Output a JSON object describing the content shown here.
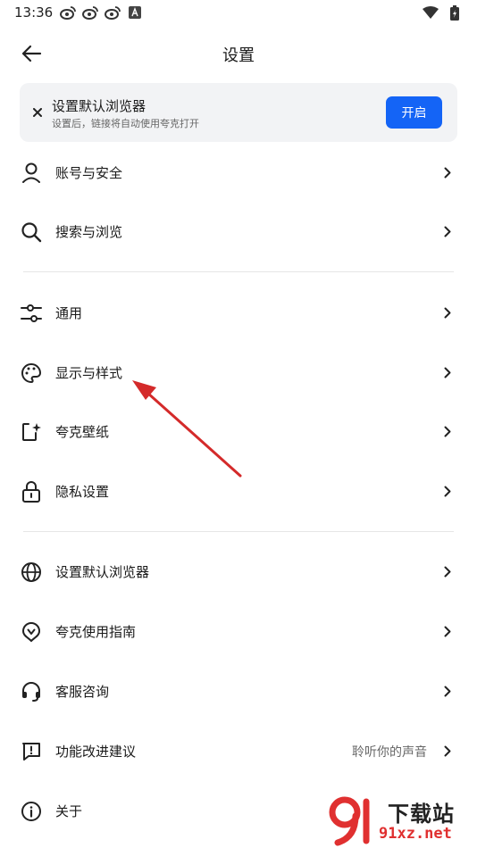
{
  "status_bar": {
    "time": "13:36",
    "left_icons": [
      "weibo-icon",
      "weibo-icon",
      "weibo-icon",
      "a-badge-icon"
    ],
    "right_icons": [
      "wifi-icon",
      "battery-icon"
    ]
  },
  "header": {
    "title": "设置",
    "back_icon": "arrow-left-icon"
  },
  "banner": {
    "close_icon": "close-icon",
    "title": "设置默认浏览器",
    "subtitle": "设置后，链接将自动使用夸克打开",
    "button_label": "开启",
    "button_color": "#1464f6"
  },
  "groups": [
    {
      "items": [
        {
          "label": "账号与安全",
          "icon": "user-icon"
        },
        {
          "label": "搜索与浏览",
          "icon": "search-icon"
        }
      ]
    },
    {
      "items": [
        {
          "label": "通用",
          "icon": "sliders-icon"
        },
        {
          "label": "显示与样式",
          "icon": "palette-icon"
        },
        {
          "label": "夸克壁纸",
          "icon": "wallpaper-icon"
        },
        {
          "label": "隐私设置",
          "icon": "lock-icon"
        }
      ]
    },
    {
      "items": [
        {
          "label": "设置默认浏览器",
          "icon": "globe-icon"
        },
        {
          "label": "夸克使用指南",
          "icon": "guide-icon"
        },
        {
          "label": "客服咨询",
          "icon": "headset-icon"
        },
        {
          "label": "功能改进建议",
          "icon": "feedback-icon",
          "value": "聆听你的声音"
        },
        {
          "label": "关于",
          "icon": "info-icon"
        }
      ]
    }
  ],
  "annotation": {
    "color": "#d42a2a"
  },
  "watermark": {
    "text_cn": "下载站",
    "text_en": "91xz.net",
    "color": "#e03030"
  }
}
